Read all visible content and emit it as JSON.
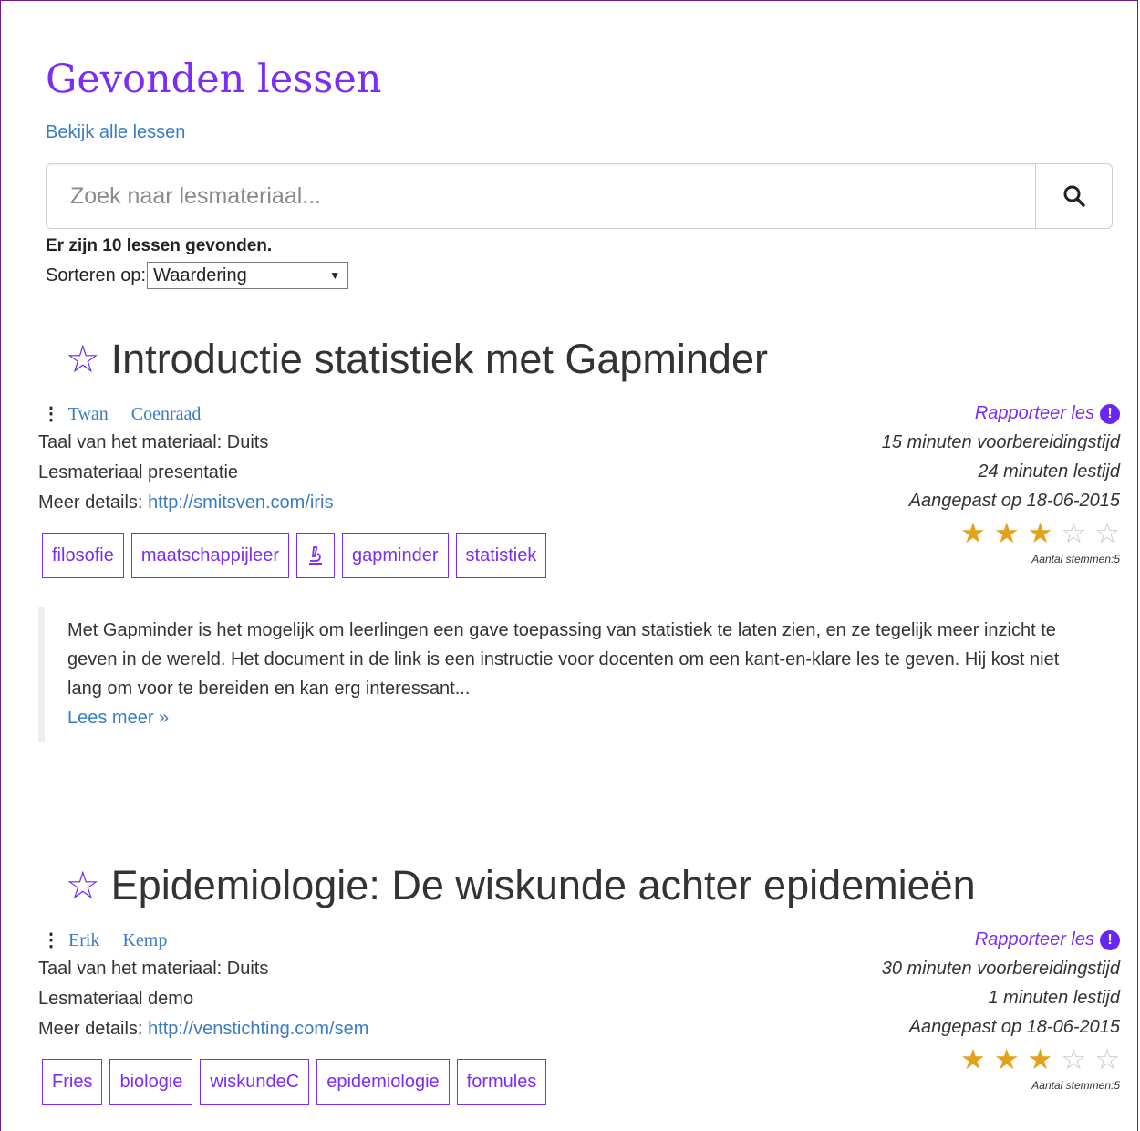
{
  "page": {
    "title": "Gevonden lessen",
    "all_link": "Bekijk alle lessen",
    "search_placeholder": "Zoek naar lesmateriaal...",
    "result_count": "Er zijn 10 lessen gevonden.",
    "sort_label": "Sorteren op:",
    "sort_value": "Waardering"
  },
  "colors": {
    "accent": "#7b2cf5",
    "link": "#3a7cc4",
    "star": "#e3a21a"
  },
  "lessons": [
    {
      "title": "Introductie statistiek met Gapminder",
      "author_first": "Twan",
      "author_last": "Coenraad",
      "language": "Taal van het materiaal: Duits",
      "material": "Lesmateriaal presentatie",
      "details_label": "Meer details:",
      "details_url": "http://smitsven.com/iris",
      "tags": [
        "filosofie",
        "maatschappijleer",
        "⚗",
        "gapminder",
        "statistiek"
      ],
      "report": "Rapporteer les",
      "prep_time": "15 minuten voorbereidingstijd",
      "lesson_time": "24 minuten lestijd",
      "modified": "Aangepast op 18-06-2015",
      "rating": 3,
      "rating_max": 5,
      "votes": "Aantal stemmen:5",
      "description": "Met Gapminder is het mogelijk om leerlingen een gave toepassing van statistiek te laten zien, en ze tegelijk meer inzicht te geven in de wereld. Het document in de link is een instructie voor docenten om een kant-en-klare les te geven. Hij kost niet lang om voor te bereiden en kan erg interessant...",
      "read_more": "Lees meer »"
    },
    {
      "title": "Epidemiologie: De wiskunde achter epidemieën",
      "author_first": "Erik",
      "author_last": "Kemp",
      "language": "Taal van het materiaal: Duits",
      "material": "Lesmateriaal demo",
      "details_label": "Meer details:",
      "details_url": "http://venstichting.com/sem",
      "tags": [
        "Fries",
        "biologie",
        "wiskundeC",
        "epidemiologie",
        "formules"
      ],
      "report": "Rapporteer les",
      "prep_time": "30 minuten voorbereidingstijd",
      "lesson_time": "1 minuten lestijd",
      "modified": "Aangepast op 18-06-2015",
      "rating": 3,
      "rating_max": 5,
      "votes": "Aantal stemmen:5"
    }
  ]
}
